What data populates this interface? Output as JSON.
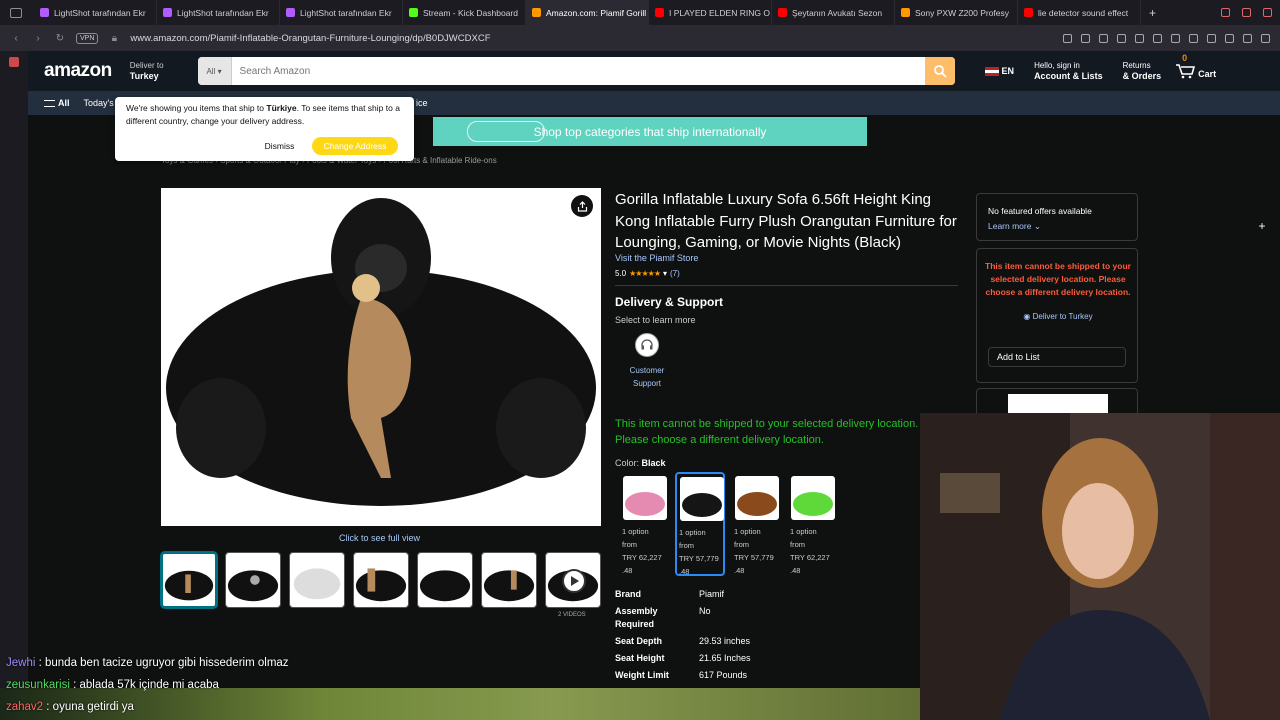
{
  "browser": {
    "tabs": [
      {
        "label": "LightShot tarafından Ekr",
        "color": "#b05cff"
      },
      {
        "label": "LightShot tarafından Ekr",
        "color": "#b05cff"
      },
      {
        "label": "LightShot tarafından Ekr",
        "color": "#b05cff"
      },
      {
        "label": "Stream - Kick Dashboard",
        "color": "#53fc18"
      },
      {
        "label": "Amazon.com: Piamif Gorill",
        "color": "#ff9900"
      },
      {
        "label": "I PLAYED ELDEN RING O",
        "color": "#ff0000"
      },
      {
        "label": "Şeytanın Avukatı Sezon",
        "color": "#ff0000"
      },
      {
        "label": "Sony PXW Z200 Profesy",
        "color": "#ff9900"
      },
      {
        "label": "lie detector sound effect",
        "color": "#ff0000"
      }
    ],
    "vpn": "VPN",
    "url": "www.amazon.com/Piamif-Inflatable-Orangutan-Furniture-Lounging/dp/B0DJWCDXCF"
  },
  "header": {
    "logo": "amazon",
    "deliver_to": "Deliver to",
    "deliver_country": "Turkey",
    "search_category": "All",
    "search_placeholder": "Search Amazon",
    "lang": "EN",
    "hello": "Hello, sign in",
    "account": "Account & Lists",
    "returns": "Returns",
    "orders": "& Orders",
    "cart_count": "0",
    "cart": "Cart"
  },
  "subnav": {
    "all": "All",
    "todays": "Today's",
    "ice": "ice"
  },
  "popup": {
    "message_pre": "We're showing you items that ship to ",
    "country": "Türkiye",
    "message_post": ". To see items that ship to a different country, change your delivery address.",
    "dismiss": "Dismiss",
    "change": "Change Address"
  },
  "banner": "Shop top categories that ship internationally",
  "breadcrumb": "Toys & Games › Sports & Outdoor Play › Pools & Water Toys › Pool Rafts & Inflatable Ride-ons",
  "product": {
    "title": "Gorilla Inflatable Luxury Sofa 6.56ft Height King Kong Inflatable Furry Plush Orangutan Furniture for Lounging, Gaming, or Movie Nights (Black)",
    "store": "Visit the Piamif Store",
    "rating": "5.0",
    "stars": "★★★★★",
    "rating_count": "(7)",
    "full_view": "Click to see full view",
    "videos_label": "2 VIDEOS",
    "delivery_title": "Delivery & Support",
    "delivery_sub": "Select to learn more",
    "customer_support": "Customer Support",
    "ship_msg_1": "This item cannot be shipped to your selected delivery location.",
    "ship_msg_2": "Please choose a different delivery location.",
    "color_label": "Color:",
    "color_value": "Black",
    "swatches": [
      {
        "line1": "1 option",
        "line2": "from",
        "line3": "TRY 62,227",
        "line4": ".48",
        "color": "#e58ab0"
      },
      {
        "line1": "1 option",
        "line2": "from",
        "line3": "TRY 57,779",
        "line4": ".48",
        "color": "#151515"
      },
      {
        "line1": "1 option",
        "line2": "from",
        "line3": "TRY 57,779",
        "line4": ".48",
        "color": "#8a4a1c"
      },
      {
        "line1": "1 option",
        "line2": "from",
        "line3": "TRY 62,227",
        "line4": ".48",
        "color": "#5fd83a"
      }
    ],
    "specs": [
      {
        "k": "Brand",
        "v": "Piamif"
      },
      {
        "k": "Assembly Required",
        "v": "No"
      },
      {
        "k": "Seat Depth",
        "v": "29.53 inches"
      },
      {
        "k": "Seat Height",
        "v": "21.65 Inches"
      },
      {
        "k": "Weight Limit",
        "v": "617 Pounds"
      }
    ]
  },
  "buybox": {
    "no_offers": "No featured offers available",
    "learn_more": "Learn more",
    "red_msg": "This item cannot be shipped to your selected delivery location. Please choose a different delivery location.",
    "deliver_to": "Deliver to Turkey",
    "add_to_list": "Add to List"
  },
  "chat": [
    {
      "user": "Jewhi",
      "text": " : bunda ben tacize ugruyor gibi hissederim olmaz"
    },
    {
      "user": "zeusunkarisi",
      "text": " : ablada 57k içinde mi acaba"
    },
    {
      "user": "zahav2",
      "text": " : oyuna getirdi ya"
    }
  ]
}
